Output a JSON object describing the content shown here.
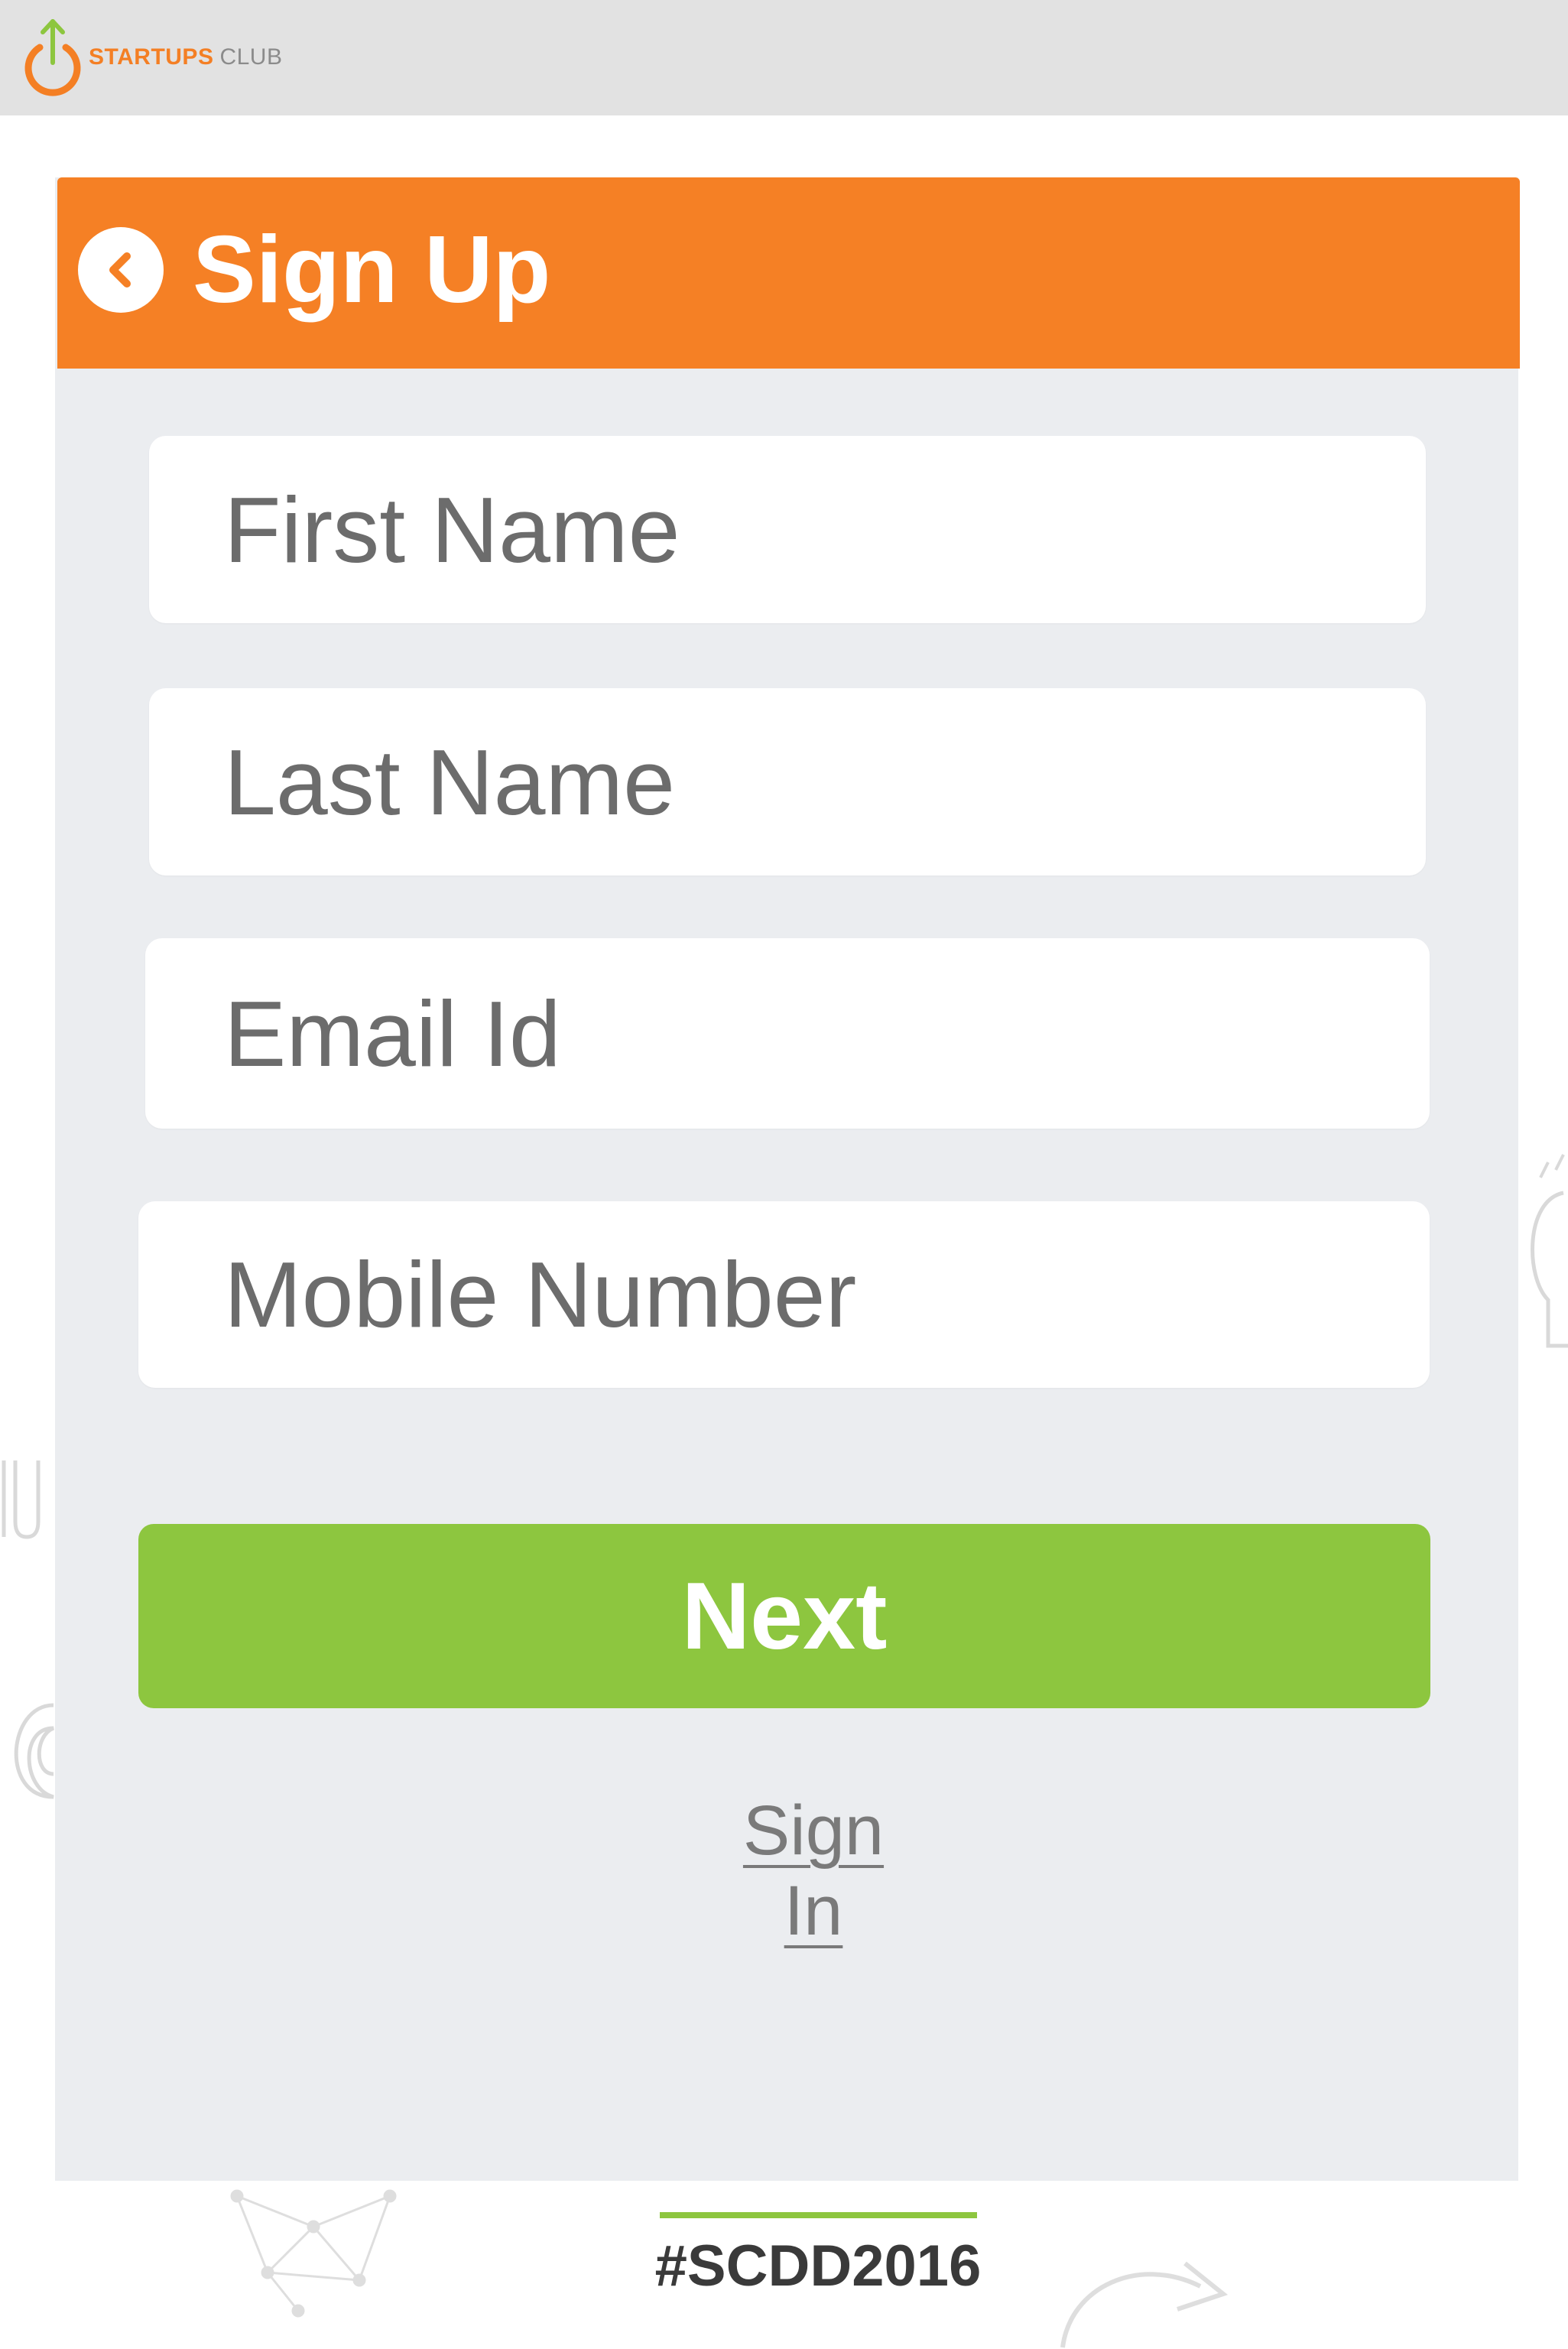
{
  "header": {
    "logo_brand": "STARTUPS",
    "logo_club": "CLUB"
  },
  "form": {
    "title": "Sign Up",
    "back_icon": "chevron-left-icon",
    "fields": {
      "first_name_placeholder": "First Name",
      "last_name_placeholder": "Last Name",
      "email_placeholder": "Email Id",
      "mobile_placeholder": "Mobile Number"
    },
    "next_label": "Next",
    "signin_label": "Sign In"
  },
  "footer": {
    "hashtag": "#SCDD2016"
  },
  "colors": {
    "accent": "#f58025",
    "success": "#8dc63f",
    "card_bg": "#ebedf0",
    "topbar_bg": "#e2e2e2"
  }
}
